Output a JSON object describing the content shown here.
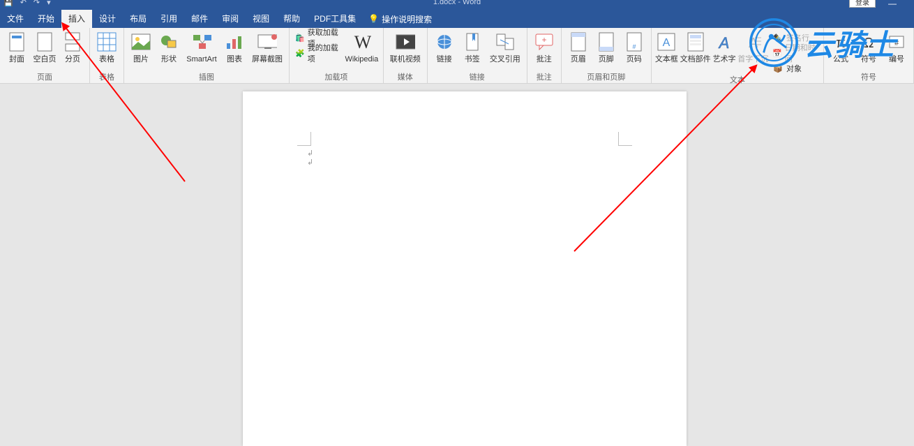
{
  "title": "1.docx - Word",
  "login": "登录",
  "tabs": {
    "file": "文件",
    "home": "开始",
    "insert": "插入",
    "design": "设计",
    "layout": "布局",
    "references": "引用",
    "mailings": "邮件",
    "review": "审阅",
    "view": "视图",
    "help": "帮助",
    "pdftools": "PDF工具集",
    "search": "操作说明搜索"
  },
  "ribbon": {
    "pages": {
      "group": "页面",
      "cover": "封面",
      "blank": "空白页",
      "break": "分页"
    },
    "tables": {
      "group": "表格",
      "table": "表格"
    },
    "illus": {
      "group": "插图",
      "picture": "图片",
      "shapes": "形状",
      "smartart": "SmartArt",
      "chart": "图表",
      "screenshot": "屏幕截图"
    },
    "addins": {
      "group": "加载项",
      "get": "获取加载项",
      "my": "我的加载项",
      "wiki": "Wikipedia"
    },
    "media": {
      "group": "媒体",
      "video": "联机视频"
    },
    "links": {
      "group": "链接",
      "link": "链接",
      "bookmark": "书签",
      "crossref": "交叉引用"
    },
    "comments": {
      "group": "批注",
      "comment": "批注"
    },
    "headerfooter": {
      "group": "页眉和页脚",
      "header": "页眉",
      "footer": "页脚",
      "pagenum": "页码"
    },
    "text": {
      "group": "文本",
      "textbox": "文本框",
      "quickparts": "文档部件",
      "wordart": "艺术字",
      "dropcap": "首字下沉",
      "sigline": "签名行",
      "datetime": "日期和时间",
      "object": "对象"
    },
    "symbols": {
      "group": "符号",
      "equation": "公式",
      "symbol": "符号",
      "number": "编号"
    }
  },
  "watermark": "云骑士"
}
